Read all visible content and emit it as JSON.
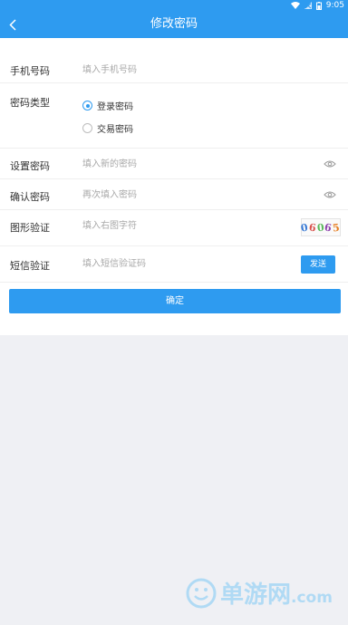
{
  "status_bar": {
    "time": "9:05"
  },
  "nav": {
    "title": "修改密码"
  },
  "form": {
    "phone": {
      "label": "手机号码",
      "placeholder": "填入手机号码"
    },
    "password_type": {
      "label": "密码类型",
      "options": [
        {
          "label": "登录密码",
          "selected": true
        },
        {
          "label": "交易密码",
          "selected": false
        }
      ]
    },
    "new_password": {
      "label": "设置密码",
      "placeholder": "填入新的密码"
    },
    "confirm_password": {
      "label": "确认密码",
      "placeholder": "再次填入密码"
    },
    "captcha": {
      "label": "图形验证",
      "placeholder": "填入右图字符",
      "chars": [
        "0",
        "6",
        "0",
        "6",
        "5"
      ]
    },
    "sms": {
      "label": "短信验证",
      "placeholder": "填入短信验证码",
      "send_label": "发送"
    },
    "submit_label": "确定"
  },
  "watermark": {
    "text": "单游网",
    "suffix": ".com"
  },
  "colors": {
    "accent": "#2e9bf0",
    "background": "#eff0f4"
  }
}
